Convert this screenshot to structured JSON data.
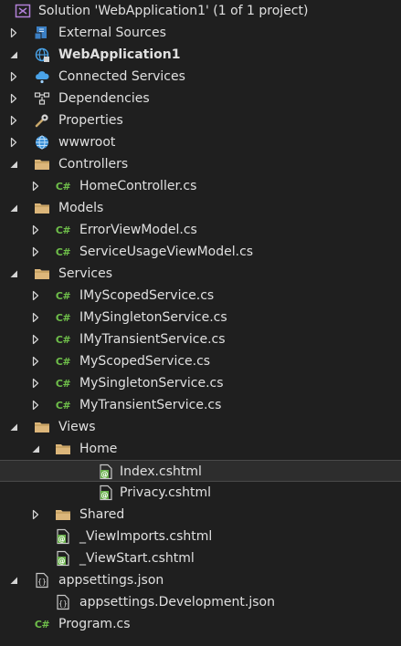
{
  "colors": {
    "background": "#1f1f1f",
    "text": "#e0e0e0",
    "csharp": "#6fbf4a",
    "folder": "#dcb67a",
    "solution": "#b180d7",
    "selected_row": "#2d2d2d"
  },
  "tree": [
    {
      "label": "Solution 'WebApplication1' (1 of 1 project)",
      "icon": "solution-icon",
      "arrow": "none",
      "depth": 0,
      "bold": false
    },
    {
      "label": "External Sources",
      "icon": "external-sources-icon",
      "arrow": "collapsed",
      "depth": 1,
      "bold": false
    },
    {
      "label": "WebApplication1",
      "icon": "web-project-icon",
      "arrow": "expanded",
      "depth": 1,
      "bold": true
    },
    {
      "label": "Connected Services",
      "icon": "connected-services-icon",
      "arrow": "collapsed",
      "depth": 2,
      "bold": false
    },
    {
      "label": "Dependencies",
      "icon": "dependencies-icon",
      "arrow": "collapsed",
      "depth": 2,
      "bold": false
    },
    {
      "label": "Properties",
      "icon": "properties-icon",
      "arrow": "collapsed",
      "depth": 2,
      "bold": false
    },
    {
      "label": "wwwroot",
      "icon": "globe-icon",
      "arrow": "collapsed",
      "depth": 2,
      "bold": false
    },
    {
      "label": "Controllers",
      "icon": "folder-icon",
      "arrow": "expanded",
      "depth": 2,
      "bold": false
    },
    {
      "label": "HomeController.cs",
      "icon": "csharp-file-icon",
      "arrow": "collapsed",
      "depth": 3,
      "bold": false
    },
    {
      "label": "Models",
      "icon": "folder-icon",
      "arrow": "expanded",
      "depth": 2,
      "bold": false
    },
    {
      "label": "ErrorViewModel.cs",
      "icon": "csharp-file-icon",
      "arrow": "collapsed",
      "depth": 3,
      "bold": false
    },
    {
      "label": "ServiceUsageViewModel.cs",
      "icon": "csharp-file-icon",
      "arrow": "collapsed",
      "depth": 3,
      "bold": false
    },
    {
      "label": "Services",
      "icon": "folder-icon",
      "arrow": "expanded",
      "depth": 2,
      "bold": false
    },
    {
      "label": "IMyScopedService.cs",
      "icon": "csharp-file-icon",
      "arrow": "collapsed",
      "depth": 3,
      "bold": false
    },
    {
      "label": "IMySingletonService.cs",
      "icon": "csharp-file-icon",
      "arrow": "collapsed",
      "depth": 3,
      "bold": false
    },
    {
      "label": "IMyTransientService.cs",
      "icon": "csharp-file-icon",
      "arrow": "collapsed",
      "depth": 3,
      "bold": false
    },
    {
      "label": "MyScopedService.cs",
      "icon": "csharp-file-icon",
      "arrow": "collapsed",
      "depth": 3,
      "bold": false
    },
    {
      "label": "MySingletonService.cs",
      "icon": "csharp-file-icon",
      "arrow": "collapsed",
      "depth": 3,
      "bold": false
    },
    {
      "label": "MyTransientService.cs",
      "icon": "csharp-file-icon",
      "arrow": "collapsed",
      "depth": 3,
      "bold": false
    },
    {
      "label": "Views",
      "icon": "folder-icon",
      "arrow": "expanded",
      "depth": 2,
      "bold": false
    },
    {
      "label": "Home",
      "icon": "folder-icon",
      "arrow": "expanded",
      "depth": 3,
      "bold": false
    },
    {
      "label": "Index.cshtml",
      "icon": "razor-file-icon",
      "arrow": "none",
      "depth": 4,
      "bold": false,
      "selected": true
    },
    {
      "label": "Privacy.cshtml",
      "icon": "razor-file-icon",
      "arrow": "none",
      "depth": 4,
      "bold": false
    },
    {
      "label": "Shared",
      "icon": "folder-icon",
      "arrow": "collapsed",
      "depth": 3,
      "bold": false
    },
    {
      "label": "_ViewImports.cshtml",
      "icon": "razor-file-icon",
      "arrow": "none",
      "depth": 3,
      "bold": false
    },
    {
      "label": "_ViewStart.cshtml",
      "icon": "razor-file-icon",
      "arrow": "none",
      "depth": 3,
      "bold": false
    },
    {
      "label": "appsettings.json",
      "icon": "json-file-icon",
      "arrow": "expanded",
      "depth": 2,
      "bold": false
    },
    {
      "label": "appsettings.Development.json",
      "icon": "json-file-icon",
      "arrow": "none",
      "depth": 3,
      "bold": false
    },
    {
      "label": "Program.cs",
      "icon": "csharp-file-icon",
      "arrow": "none",
      "depth": 2,
      "bold": false
    }
  ]
}
